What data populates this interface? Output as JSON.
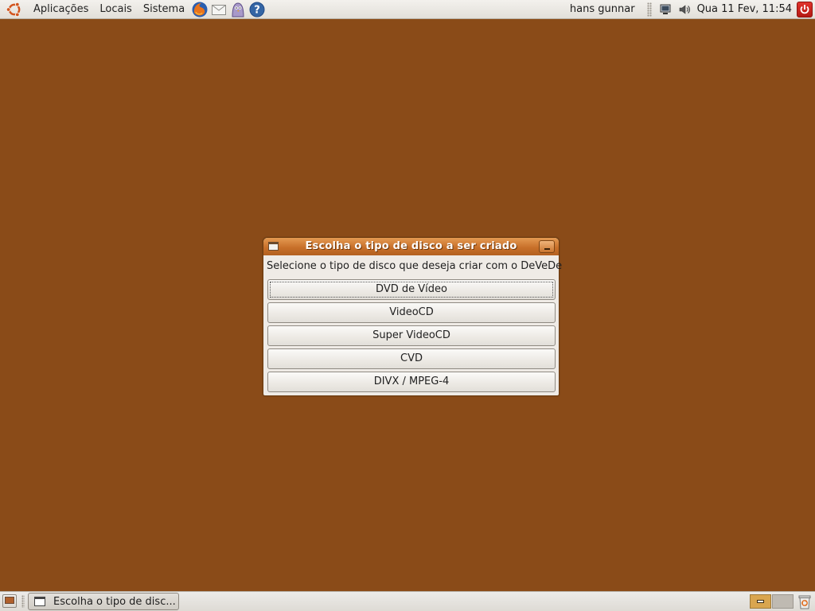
{
  "top_panel": {
    "menus": [
      "Aplicações",
      "Locais",
      "Sistema"
    ],
    "launchers": [
      "firefox-icon",
      "mail-icon",
      "pidgin-icon",
      "help-icon"
    ],
    "user_name": "hans gunnar",
    "clock": "Qua 11 Fev, 11:54"
  },
  "dialog": {
    "title": "Escolha o tipo de disco a ser criado",
    "prompt": "Selecione o tipo de disco que deseja criar com o DeVeDe",
    "buttons": [
      "DVD de Vídeo",
      "VideoCD",
      "Super VideoCD",
      "CVD",
      "DIVX / MPEG-4"
    ],
    "focused_button": "DVD de Vídeo"
  },
  "bottom_panel": {
    "taskbar_label": "Escolha o tipo de disc...",
    "active_workspace": 1,
    "workspace_count": 2
  },
  "colors": {
    "desktop": "#8a4b18",
    "titlebar": "#c8702a",
    "panel": "#e8e6e2"
  }
}
